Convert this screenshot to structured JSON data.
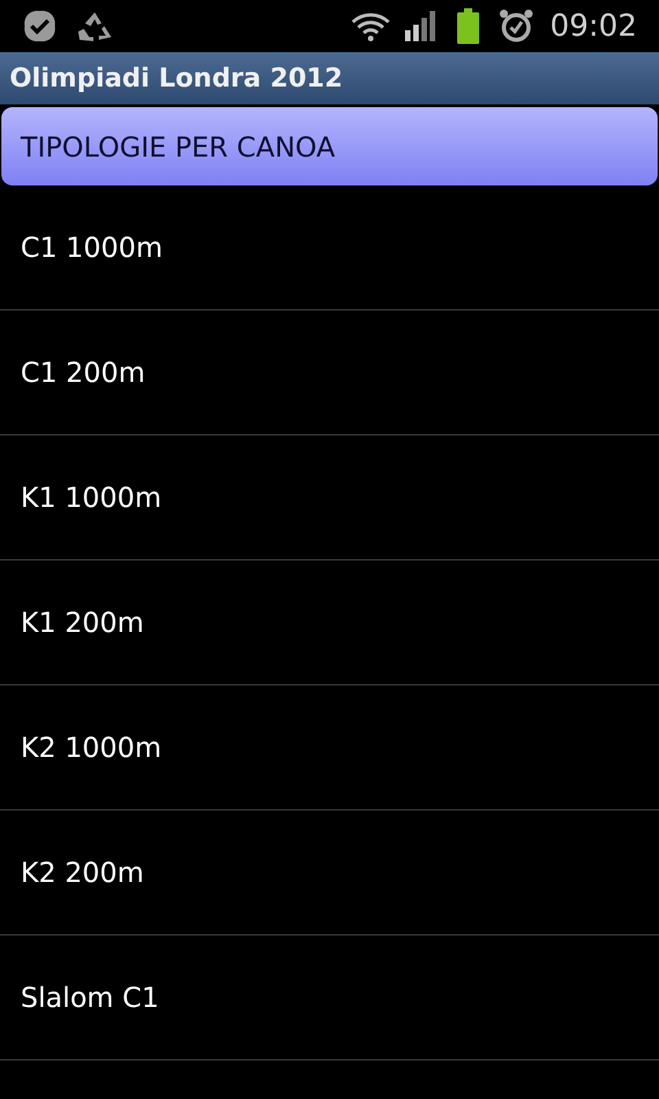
{
  "status_bar": {
    "time": "09:02"
  },
  "title_bar": {
    "title": "Olimpiadi Londra 2012"
  },
  "header": {
    "label": "TIPOLOGIE PER CANOA"
  },
  "items": [
    {
      "label": "C1 1000m"
    },
    {
      "label": "C1 200m"
    },
    {
      "label": "K1 1000m"
    },
    {
      "label": "K1 200m"
    },
    {
      "label": "K2 1000m"
    },
    {
      "label": "K2 200m"
    },
    {
      "label": "Slalom C1"
    }
  ]
}
